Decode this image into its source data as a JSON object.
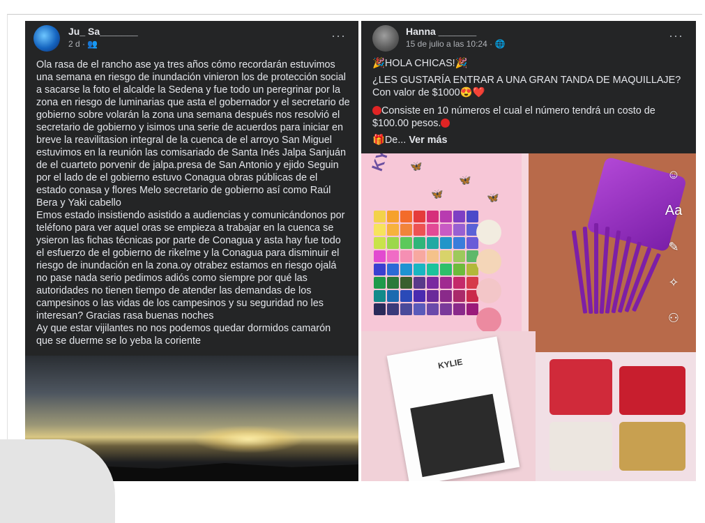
{
  "left_post": {
    "author": "Ju_ Sa_______",
    "time": "2 d ·",
    "audience_icon": "friends-icon",
    "menu_glyph": "···",
    "paragraphs": [
      "Ola rasa de el rancho ase ya tres años cómo recordarán estuvimos una semana en riesgo de inundación vinieron los de protección social a sacarse la foto el alcalde la Sedena  y fue todo un peregrinar por la zona en riesgo de luminarias que asta el gobernador y el secretario de gobierno sobre volarán la zona una semana después nos resolvió el secretario de gobierno y isimos una serie de acuerdos para iniciar en breve la reavilitasion integral de la cuenca de el arroyo San Miguel estuvimos en la reunión las comisariado de Santa Inés Jalpa Sanjuán de el cuarteto porvenir de jalpa.presa de San Antonio y ejido Seguin  por el lado de el gobierno estuvo Conagua obras públicas de el estado conasa y flores Melo secretario de gobierno así como Raúl Bera y Yaki cabello",
      "Emos estado insistiendo asistido a audiencias y comunicándonos por teléfono  para ver aquel oras se empieza a trabajar en la cuenca se ysieron las fichas técnicas por parte de Conagua y asta hay fue todo el esfuerzo de el gobierno de rikelme y la Conagua para disminuir el riesgo de inundación en la zona.oy otrabez estamos en riesgo ojalá no pase nada serio pedimos adiós como siempre por qué las autoridades no tienen tiempo de atender las demandas de los campesinos o las vidas  de los campesinos y su seguridad no les interesan? Gracias rasa buenas noches",
      "Ay que estar vijilantes no nos podemos quedar dormidos camarón que se duerme se lo yeba la coriente"
    ]
  },
  "right_post": {
    "author": "Hanna _______",
    "time": "15 de julio a las 10:24 ·",
    "audience_icon": "globe-icon",
    "menu_glyph": "···",
    "line1": "🎉HOLA CHICAS!🎉",
    "line2": "¿LES GUSTARÍA ENTRAR A UNA GRAN TANDA DE MAQUILLAJE? Con valor de $1000😍❤️",
    "line3_a": "Consiste en 10 números el cual el número tendrá un costo de $100.00 pesos.",
    "line4_prefix": "🎁De...",
    "see_more": "Ver más",
    "palette_brand": "KYLIE",
    "lash_brand": "KYLIE",
    "side_tool_text": "Aa",
    "side_icons": [
      "sticker-icon",
      "text-icon",
      "draw-icon",
      "effects-icon",
      "tag-person-icon"
    ]
  },
  "colors": {
    "post_bg": "#242526",
    "text": "#e4e6eb",
    "muted": "#b0b3b8",
    "page_bg": "#ffffff"
  }
}
